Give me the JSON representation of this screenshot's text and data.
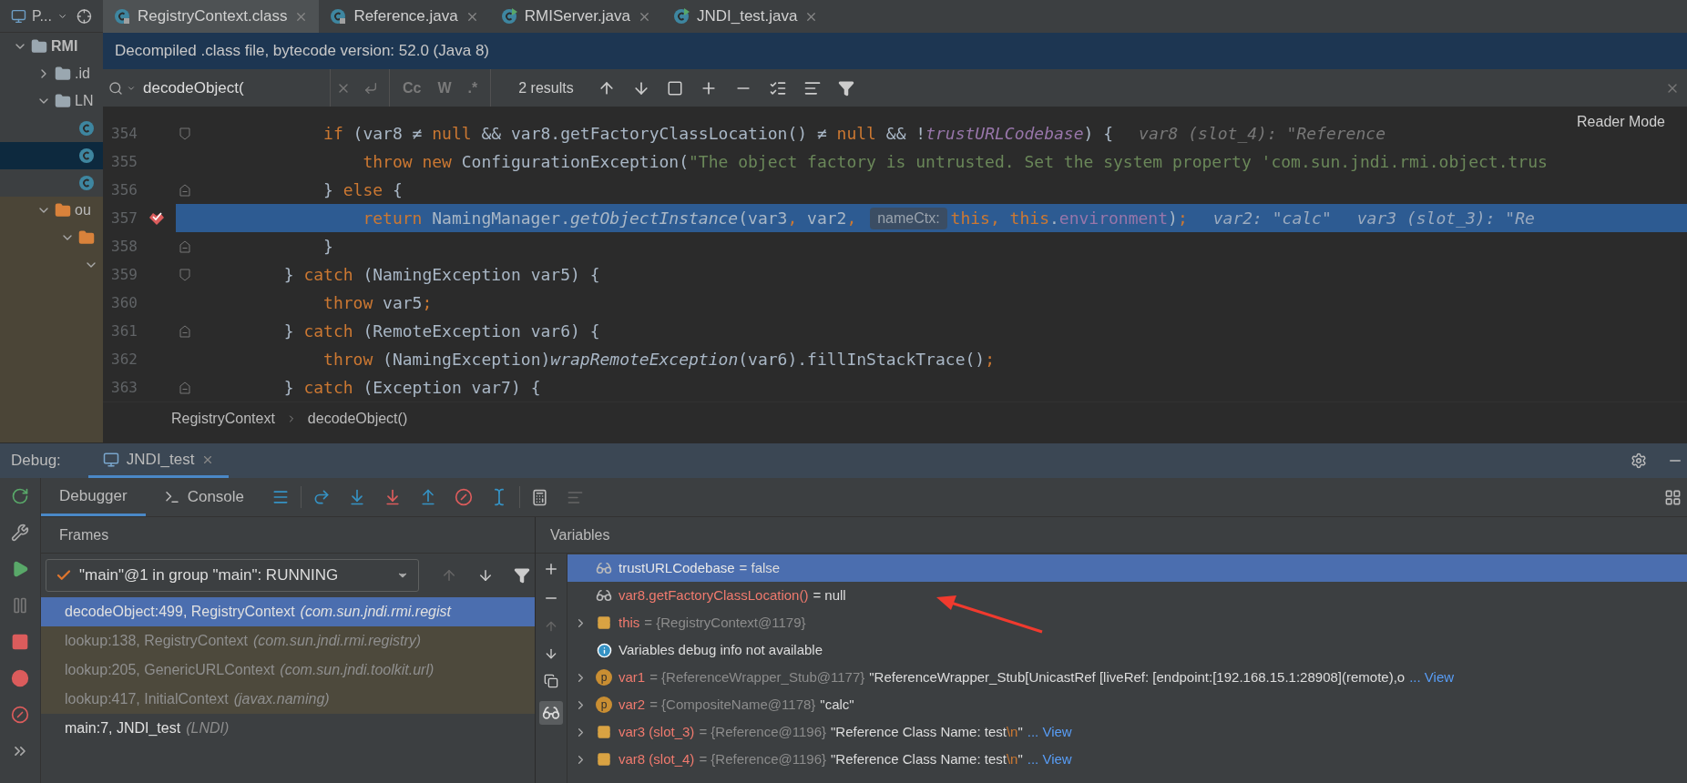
{
  "project_panel": {
    "title": "P...",
    "tree": [
      {
        "label": "RMI",
        "kind": "module",
        "expanded": true,
        "selected": false,
        "children": [
          {
            "label": ".id",
            "kind": "folder",
            "expanded": false,
            "selected": false
          },
          {
            "label": "LN",
            "kind": "module",
            "expanded": true,
            "selected": false,
            "children": [
              {
                "kind": "class",
                "selected": false
              },
              {
                "kind": "class",
                "selected": true
              },
              {
                "kind": "class",
                "selected": false
              }
            ]
          },
          {
            "label": "ou",
            "kind": "excluded",
            "expanded": true,
            "selected": false,
            "children": [
              {
                "kind": "excluded",
                "expanded": true,
                "selected": false,
                "children": [
                  {
                    "kind": "stub",
                    "expanded": true,
                    "selected": false
                  }
                ]
              }
            ]
          }
        ]
      }
    ]
  },
  "editor_tabs": [
    {
      "label": "RegistryContext.class",
      "kind": "locked",
      "selected": true
    },
    {
      "label": "Reference.java",
      "kind": "locked",
      "selected": false
    },
    {
      "label": "RMIServer.java",
      "kind": "runnable",
      "selected": false
    },
    {
      "label": "JNDI_test.java",
      "kind": "runnable",
      "selected": false
    }
  ],
  "banner": "Decompiled .class file, bytecode version: 52.0 (Java 8)",
  "find_bar": {
    "query": "decodeObject(",
    "options": [
      "Cc",
      "W",
      ".*"
    ],
    "results": "2 results"
  },
  "reader_mode": "Reader Mode",
  "code_lines": [
    {
      "number": "354",
      "fold": {
        "kind": "start"
      },
      "tokens": [
        {
          "t": "            if",
          "kind": "kw"
        },
        {
          "t": " (var8 ≠ ",
          "kind": "txt"
        },
        {
          "t": "null",
          "kind": "kw"
        },
        {
          "t": " && var8.getFactoryClassLocation() ≠ ",
          "kind": "txt"
        },
        {
          "t": "null",
          "kind": "kw"
        },
        {
          "t": " && !",
          "kind": "txt"
        },
        {
          "t": "trustURLCodebase",
          "kind": "fldi"
        },
        {
          "t": ") {",
          "kind": "txt"
        }
      ],
      "hints": [
        "var8 (slot_4): \"Reference"
      ],
      "current": false,
      "breakpoint": false
    },
    {
      "number": "355",
      "tokens": [
        {
          "t": "                throw new ",
          "kind": "kw"
        },
        {
          "t": "ConfigurationException(",
          "kind": "txt"
        },
        {
          "t": "\"The object factory is untrusted. Set the system property 'com.sun.jndi.rmi.object.trus",
          "kind": "str"
        }
      ],
      "current": false,
      "breakpoint": false
    },
    {
      "number": "356",
      "fold": {
        "kind": "end"
      },
      "tokens": [
        {
          "t": "            } ",
          "kind": "txt"
        },
        {
          "t": "else",
          "kind": "kw"
        },
        {
          "t": " {",
          "kind": "txt"
        }
      ],
      "current": false,
      "breakpoint": false
    },
    {
      "number": "357",
      "tokens": [
        {
          "t": "                return ",
          "kind": "kw"
        },
        {
          "t": "NamingManager.",
          "kind": "txt"
        },
        {
          "t": "getObjectInstance",
          "kind": "mi"
        },
        {
          "t": "(var3",
          "kind": "txt"
        },
        {
          "t": ", ",
          "kind": "kw"
        },
        {
          "t": "var2",
          "kind": "txt"
        },
        {
          "t": ", ",
          "kind": "kw"
        },
        {
          "t": "nameCtx:",
          "kind": "inlay"
        },
        {
          "t": "this, this",
          "kind": "kw"
        },
        {
          "t": ".",
          "kind": "txt"
        },
        {
          "t": "environment",
          "kind": "fld"
        },
        {
          "t": ")",
          "kind": "txt"
        },
        {
          "t": ";",
          "kind": "kw"
        }
      ],
      "hints": [
        "var2: \"calc\"",
        "var3 (slot_3): \"Re"
      ],
      "current": true,
      "breakpoint": true
    },
    {
      "number": "358",
      "fold": {
        "kind": "end"
      },
      "tokens": [
        {
          "t": "            }",
          "kind": "txt"
        }
      ],
      "current": false,
      "breakpoint": false
    },
    {
      "number": "359",
      "fold": {
        "kind": "start"
      },
      "tokens": [
        {
          "t": "        } ",
          "kind": "txt"
        },
        {
          "t": "catch",
          "kind": "kw"
        },
        {
          "t": " (NamingException var5) {",
          "kind": "txt"
        }
      ],
      "current": false,
      "breakpoint": false
    },
    {
      "number": "360",
      "tokens": [
        {
          "t": "            throw ",
          "kind": "kw"
        },
        {
          "t": "var5",
          "kind": "txt"
        },
        {
          "t": ";",
          "kind": "kw"
        }
      ],
      "current": false,
      "breakpoint": false
    },
    {
      "number": "361",
      "fold": {
        "kind": "end"
      },
      "tokens": [
        {
          "t": "        } ",
          "kind": "txt"
        },
        {
          "t": "catch",
          "kind": "kw"
        },
        {
          "t": " (RemoteException var6) {",
          "kind": "txt"
        }
      ],
      "current": false,
      "breakpoint": false
    },
    {
      "number": "362",
      "tokens": [
        {
          "t": "            throw ",
          "kind": "kw"
        },
        {
          "t": "(NamingException)",
          "kind": "txt"
        },
        {
          "t": "wrapRemoteException",
          "kind": "mi"
        },
        {
          "t": "(var6).fillInStackTrace()",
          "kind": "txt"
        },
        {
          "t": ";",
          "kind": "kw"
        }
      ],
      "current": false,
      "breakpoint": false
    },
    {
      "number": "363",
      "fold": {
        "kind": "end"
      },
      "tokens": [
        {
          "t": "        } ",
          "kind": "txt"
        },
        {
          "t": "catch",
          "kind": "kw"
        },
        {
          "t": " (Exception var7) {",
          "kind": "txt"
        }
      ],
      "current": false,
      "breakpoint": false
    }
  ],
  "breadcrumb": [
    "RegistryContext",
    "decodeObject()"
  ],
  "debug": {
    "label": "Debug:",
    "session_tab": {
      "label": "JNDI_test",
      "selected": true
    },
    "tabs": [
      {
        "label": "Debugger",
        "selected": true
      },
      {
        "label": "Console",
        "selected": false
      }
    ],
    "frames": {
      "title": "Frames",
      "thread": "\"main\"@1 in group \"main\": RUNNING",
      "items": [
        {
          "method": "decodeObject:499, RegistryContext",
          "package": "(com.sun.jndi.rmi.regist",
          "selected": true,
          "library": false
        },
        {
          "method": "lookup:138, RegistryContext",
          "package": "(com.sun.jndi.rmi.registry)",
          "selected": false,
          "library": true
        },
        {
          "method": "lookup:205, GenericURLContext",
          "package": "(com.sun.jndi.toolkit.url)",
          "selected": false,
          "library": true
        },
        {
          "method": "lookup:417, InitialContext",
          "package": "(javax.naming)",
          "selected": false,
          "library": true
        },
        {
          "method": "main:7, JNDI_test",
          "package": "(LNDI)",
          "selected": false,
          "library": false
        }
      ]
    },
    "variables": {
      "title": "Variables",
      "items": [
        {
          "kind": "watch",
          "selected": true,
          "name": "trustURLCodebase",
          "value": [
            {
              "t": "= false"
            }
          ]
        },
        {
          "kind": "watch",
          "selected": false,
          "name": "var8.getFactoryClassLocation()",
          "value": [
            {
              "t": "= null"
            }
          ]
        },
        {
          "kind": "field",
          "selected": false,
          "expanded": false,
          "name": "this",
          "ref": "= {RegistryContext@1179}"
        },
        {
          "kind": "info",
          "selected": false,
          "text": "Variables debug info not available"
        },
        {
          "kind": "param",
          "badge": "p",
          "selected": false,
          "expanded": false,
          "name": "var1",
          "ref": "= {ReferenceWrapper_Stub@1177}",
          "value": [
            {
              "t": "\"ReferenceWrapper_Stub[UnicastRef [liveRef: [endpoint:[192.168.15.1:28908](remote),o"
            }
          ],
          "link": "... View"
        },
        {
          "kind": "param",
          "badge": "p",
          "selected": false,
          "expanded": false,
          "name": "var2",
          "ref": "= {CompositeName@1178}",
          "value": [
            {
              "t": "\"calc\""
            }
          ]
        },
        {
          "kind": "local",
          "selected": false,
          "expanded": false,
          "name": "var3 (slot_3)",
          "ref": "= {Reference@1196}",
          "value": [
            {
              "t": "\"Reference Class Name: test"
            },
            {
              "t": "\\n",
              "kind": "esc"
            },
            {
              "t": "\""
            }
          ],
          "link": "... View"
        },
        {
          "kind": "local",
          "selected": false,
          "expanded": false,
          "name": "var8 (slot_4)",
          "ref": "= {Reference@1196}",
          "value": [
            {
              "t": "\"Reference Class Name: test"
            },
            {
              "t": "\\n",
              "kind": "esc"
            },
            {
              "t": "\""
            }
          ],
          "link": "... View"
        }
      ]
    }
  }
}
